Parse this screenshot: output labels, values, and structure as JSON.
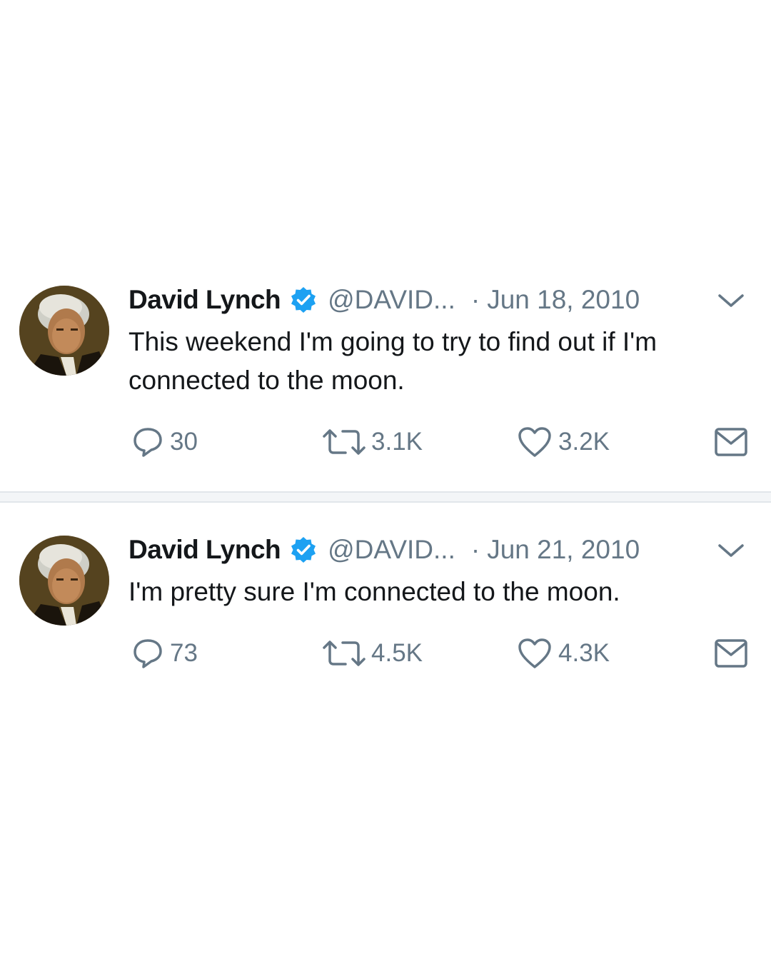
{
  "colors": {
    "text_primary": "#14171a",
    "text_secondary": "#657786",
    "verified_blue": "#1da1f2",
    "divider": "#e1e6ea"
  },
  "tweets": [
    {
      "author_name": "David Lynch",
      "handle": "@DAVID...",
      "separator": "·",
      "date": "Jun 18, 2010",
      "text": "This weekend I'm going to try to find out if I'm connected to the moon.",
      "replies": "30",
      "retweets": "3.1K",
      "likes": "3.2K",
      "icons": [
        "avatar-photo",
        "verified-badge-icon",
        "chevron-down-icon",
        "reply-icon",
        "retweet-icon",
        "heart-icon",
        "envelope-icon"
      ]
    },
    {
      "author_name": "David Lynch",
      "handle": "@DAVID...",
      "separator": "·",
      "date": "Jun 21, 2010",
      "text": "I'm pretty sure I'm connected to the moon.",
      "replies": "73",
      "retweets": "4.5K",
      "likes": "4.3K",
      "icons": [
        "avatar-photo",
        "verified-badge-icon",
        "chevron-down-icon",
        "reply-icon",
        "retweet-icon",
        "heart-icon",
        "envelope-icon"
      ]
    }
  ]
}
